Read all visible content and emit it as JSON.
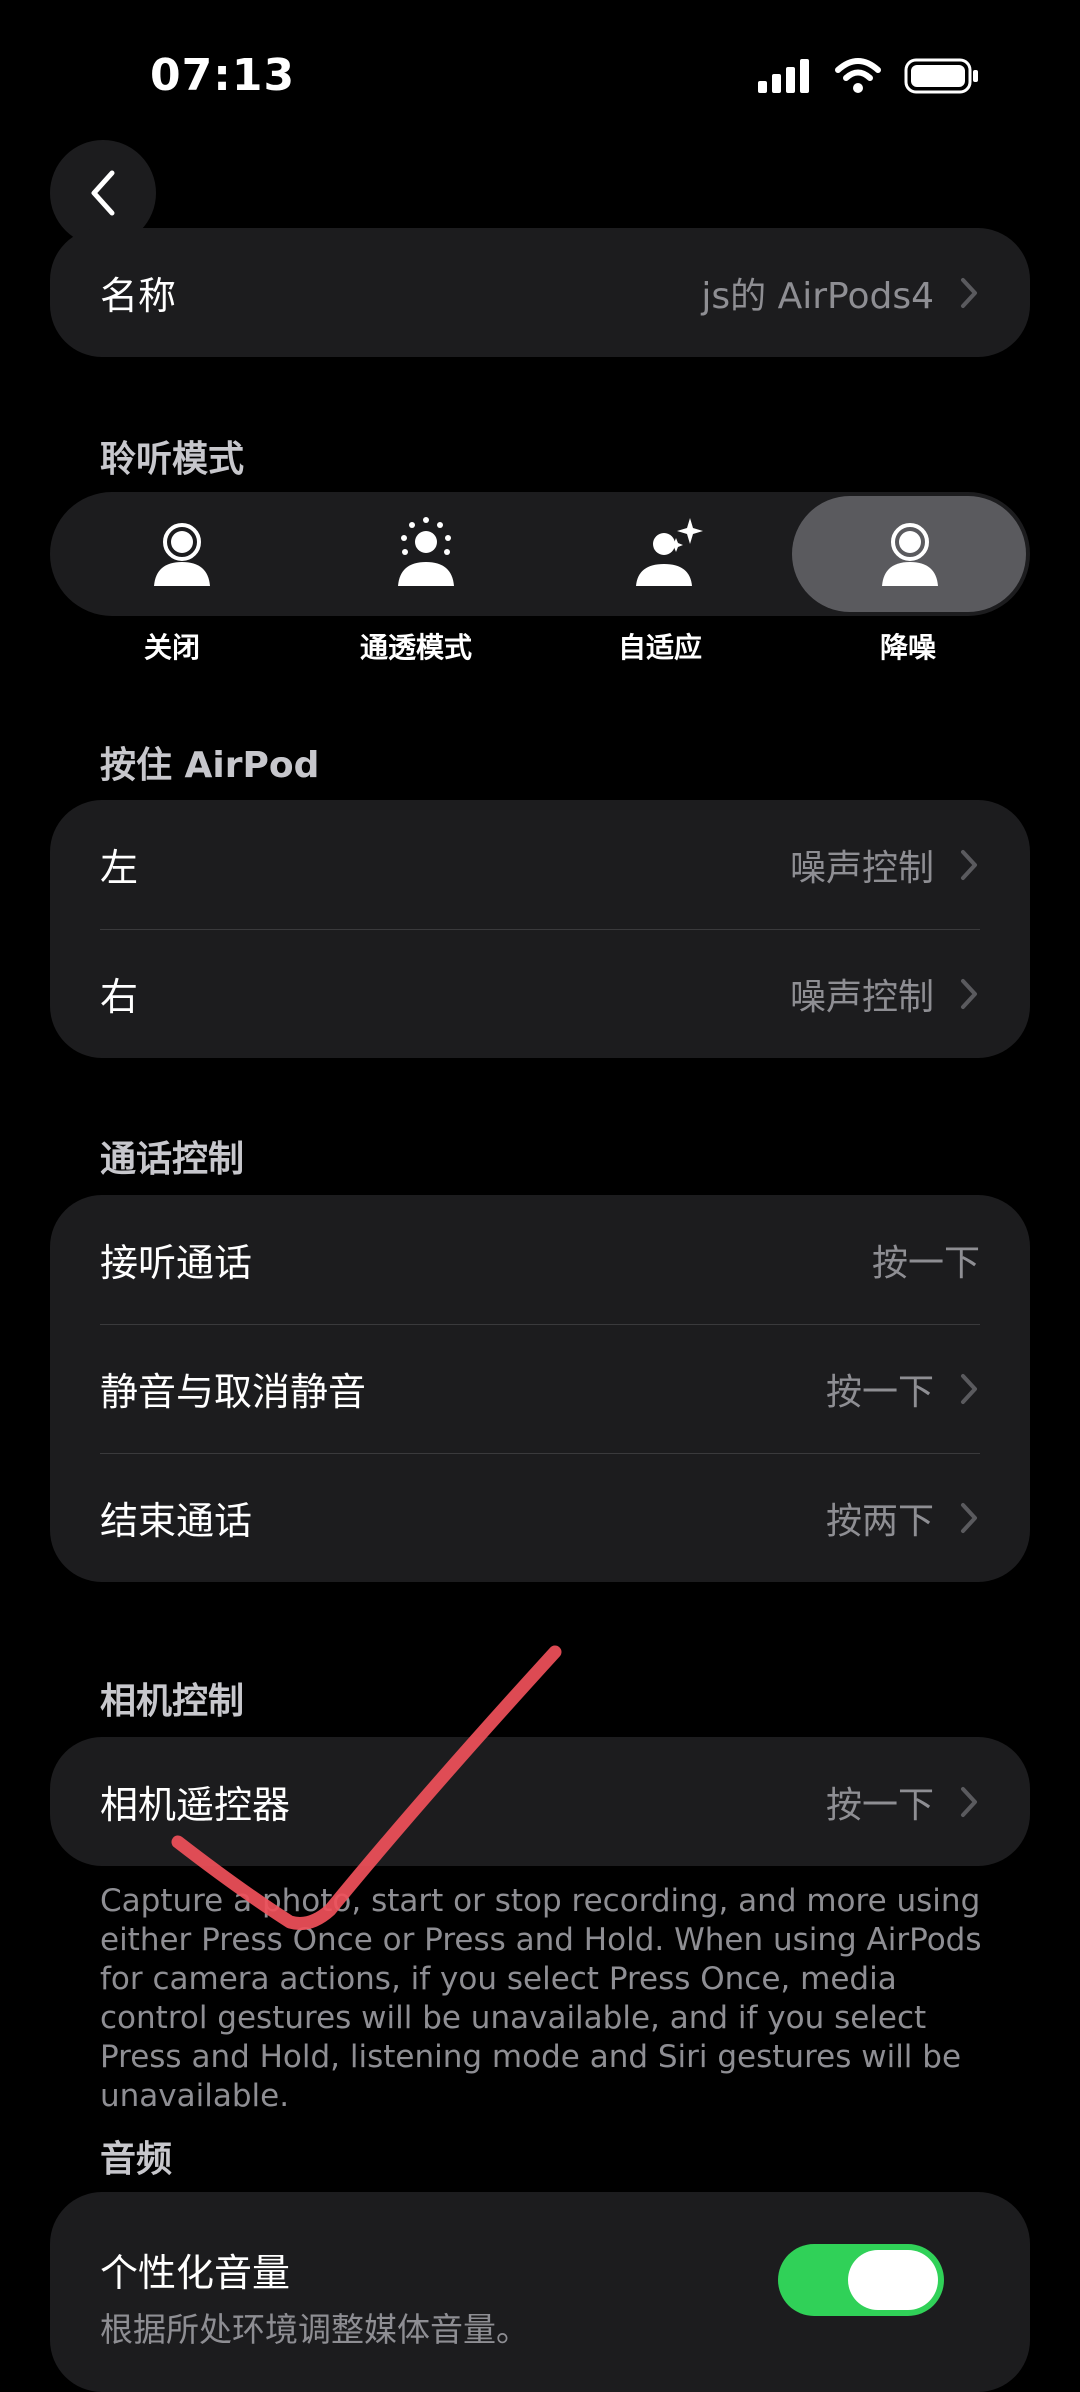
{
  "status_bar": {
    "time": "07:13"
  },
  "name_row": {
    "label": "名称",
    "value": "js的 AirPods4"
  },
  "listening": {
    "title": "聆听模式",
    "modes": [
      {
        "label": "关闭",
        "icon": "person-off-icon"
      },
      {
        "label": "通透模式",
        "icon": "person-transparency-icon"
      },
      {
        "label": "自适应",
        "icon": "person-adaptive-icon"
      },
      {
        "label": "降噪",
        "icon": "person-noise-cancel-icon",
        "selected": true
      }
    ]
  },
  "press_hold": {
    "title": "按住 AirPod",
    "rows": [
      {
        "label": "左",
        "value": "噪声控制"
      },
      {
        "label": "右",
        "value": "噪声控制"
      }
    ]
  },
  "call_controls": {
    "title": "通话控制",
    "rows": [
      {
        "label": "接听通话",
        "value": "按一下"
      },
      {
        "label": "静音与取消静音",
        "value": "按一下"
      },
      {
        "label": "结束通话",
        "value": "按两下"
      }
    ]
  },
  "camera_controls": {
    "title": "相机控制",
    "row": {
      "label": "相机遥控器",
      "value": "按一下"
    },
    "footnote": "Capture a photo, start or stop recording, and more using either Press Once or Press and Hold. When using AirPods for camera actions, if you select Press Once, media control gestures will be unavailable, and if you select Press and Hold, listening mode and Siri gestures will be unavailable."
  },
  "audio": {
    "title": "音频",
    "row": {
      "label": "个性化音量",
      "sublabel": "根据所处环境调整媒体音量。",
      "toggle_on": true
    }
  },
  "colors": {
    "toggle_on": "#30d158",
    "card": "#1c1c1e",
    "annotation": "#f0505a"
  }
}
